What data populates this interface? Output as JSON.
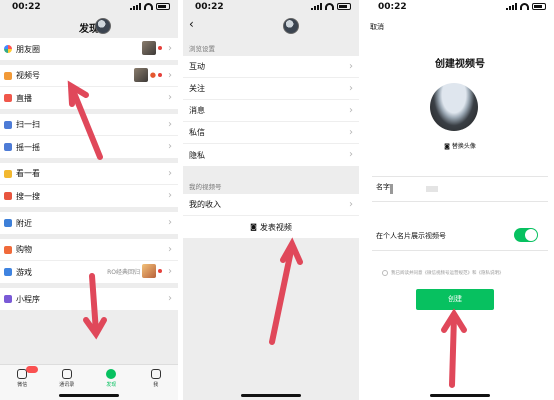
{
  "status": {
    "time": "00:22"
  },
  "screen1": {
    "title": "发现",
    "groups": [
      [
        {
          "label": "朋友圈"
        }
      ],
      [
        {
          "label": "视频号"
        },
        {
          "label": "直播"
        }
      ],
      [
        {
          "label": "扫一扫"
        },
        {
          "label": "摇一摇"
        }
      ],
      [
        {
          "label": "看一看"
        },
        {
          "label": "搜一搜"
        }
      ],
      [
        {
          "label": "附近"
        }
      ],
      [
        {
          "label": "购物"
        },
        {
          "label": "游戏",
          "extra": "RO经典回归"
        }
      ],
      [
        {
          "label": "小程序"
        }
      ]
    ],
    "tabs": [
      {
        "label": "微信"
      },
      {
        "label": "通讯录"
      },
      {
        "label": "发现"
      },
      {
        "label": "我"
      }
    ]
  },
  "screen2": {
    "section1": "浏览设置",
    "items": [
      {
        "label": "互动"
      },
      {
        "label": "关注"
      },
      {
        "label": "消息"
      },
      {
        "label": "私信"
      },
      {
        "label": "隐私"
      }
    ],
    "section2": "我的视频号",
    "income": "我的收入",
    "post": "发表视频"
  },
  "screen3": {
    "cancel": "取消",
    "title": "创建视频号",
    "change_avatar": "替换头像",
    "name_label": "名字",
    "toggle_label": "在个人名片展示视频号",
    "toggle_on": true,
    "agreement": "我已阅读并同意《微信视频号运营规范》和《隐私说明》",
    "create": "创建"
  },
  "colors": {
    "brand_green": "#07c160",
    "arrow_red": "#e0485a"
  }
}
